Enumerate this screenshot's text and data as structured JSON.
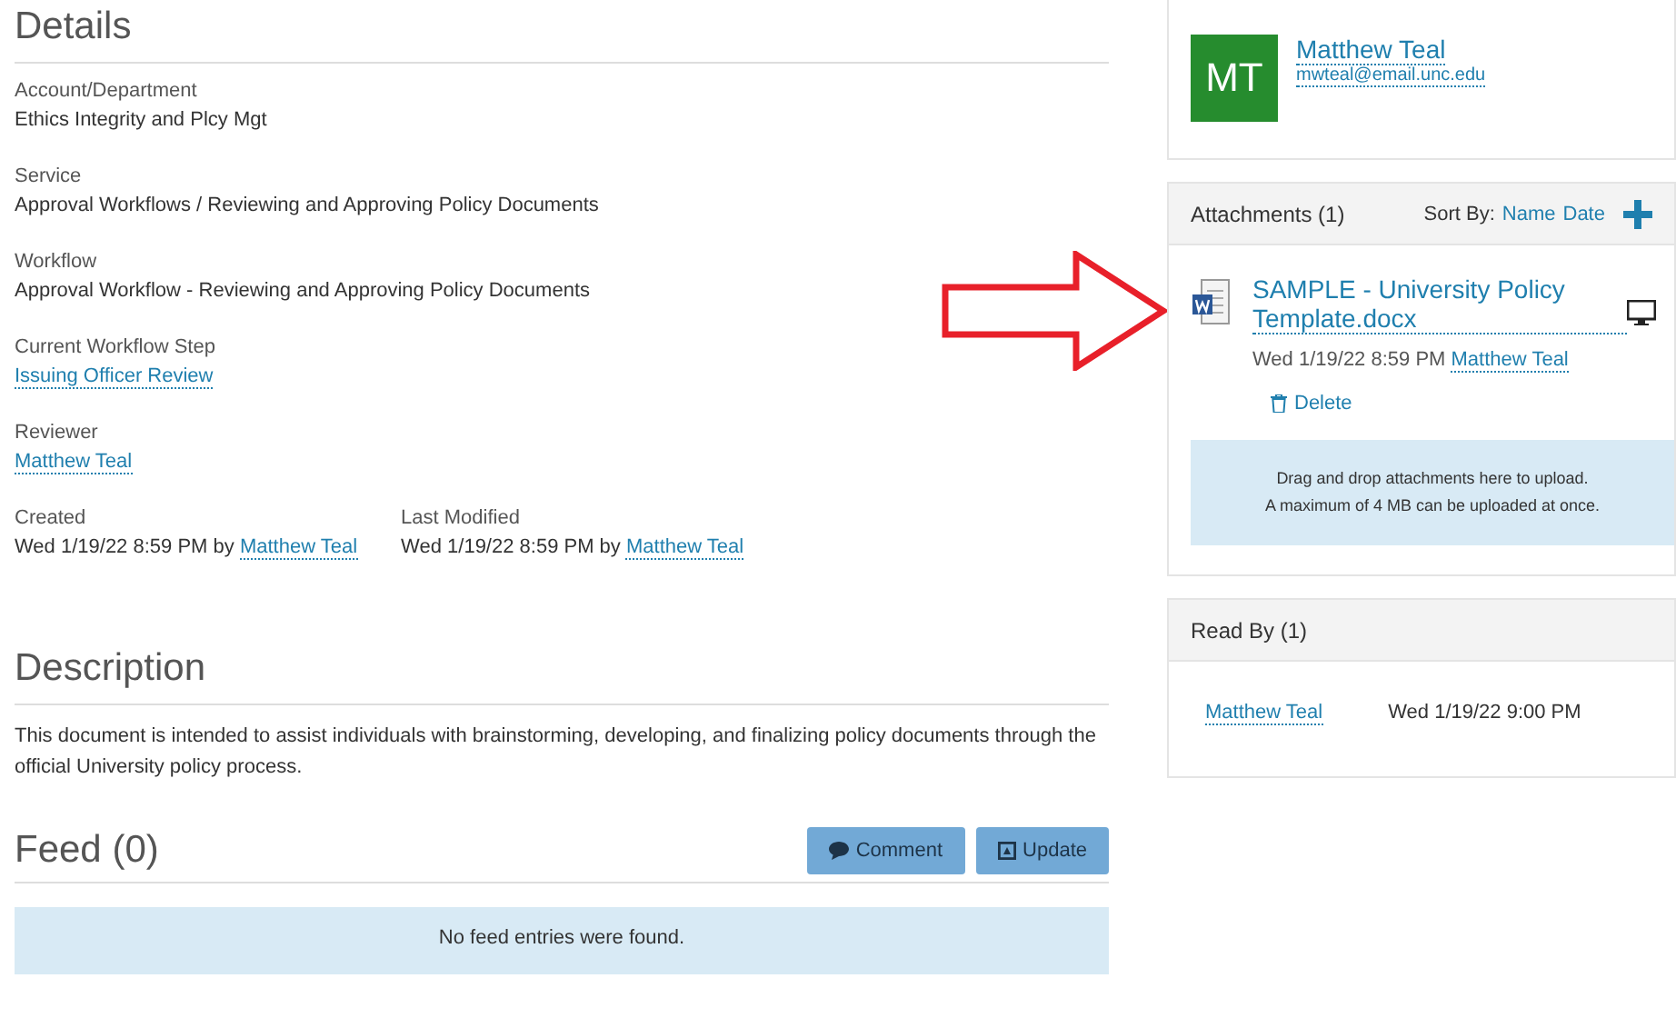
{
  "details": {
    "title": "Details",
    "fields": [
      {
        "label": "Account/Department",
        "kind": "text",
        "value": "Ethics Integrity and Plcy Mgt"
      },
      {
        "label": "Service",
        "kind": "text",
        "value": "Approval Workflows / Reviewing and Approving Policy Documents"
      },
      {
        "label": "Workflow",
        "kind": "text",
        "value": "Approval Workflow - Reviewing and Approving Policy Documents"
      },
      {
        "label": "Current Workflow Step",
        "kind": "link",
        "value": "Issuing Officer Review"
      },
      {
        "label": "Reviewer",
        "kind": "link",
        "value": "Matthew Teal"
      }
    ],
    "dates": [
      {
        "label": "Created",
        "value": "Wed 1/19/22 8:59 PM by",
        "link": "Matthew Teal"
      },
      {
        "label": "Last Modified",
        "value": "Wed 1/19/22 8:59 PM by",
        "link": "Matthew Teal"
      }
    ]
  },
  "description": {
    "title": "Description",
    "text": "This document is intended to assist individuals with brainstorming, developing, and finalizing policy documents through the official University policy process."
  },
  "feed": {
    "title": "Feed (0)",
    "buttons": [
      {
        "label": "Comment",
        "kind": "comment"
      },
      {
        "label": "Update",
        "kind": "update"
      }
    ],
    "empty": "No feed entries were found."
  },
  "contact": {
    "initials": "MT",
    "color": "#268c2e",
    "name": "Matthew Teal",
    "email": "mwteal@email.unc.edu"
  },
  "attachments": {
    "title": "Attachments (1)",
    "sort_label": "Sort By:",
    "sort_options": [
      "Name",
      "Date"
    ],
    "files": [
      {
        "name": "SAMPLE - University Policy Template.docx",
        "date": "Wed 1/19/22 8:59 PM",
        "author": "Matthew Teal",
        "delete": "Delete"
      }
    ],
    "dropzone": [
      "Drag and drop attachments here to upload.",
      "A maximum of 4 MB can be uploaded at once."
    ]
  },
  "read_by": {
    "title": "Read By (1)",
    "entries": [
      {
        "name": "Matthew Teal",
        "time": "Wed 1/19/22 9:00 PM"
      }
    ]
  }
}
